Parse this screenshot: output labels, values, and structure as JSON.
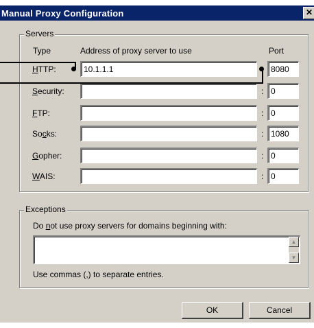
{
  "window": {
    "title": "Manual Proxy Configuration",
    "close_glyph": "✕"
  },
  "servers": {
    "group_label": "Servers",
    "col_type": "Type",
    "col_address": "Address of proxy server to use",
    "col_port": "Port",
    "rows": [
      {
        "label": "HTTP:",
        "address": "10.1.1.1",
        "port": "8080"
      },
      {
        "label": "Security:",
        "address": "",
        "port": "0"
      },
      {
        "label": "FTP:",
        "address": "",
        "port": "0"
      },
      {
        "label": "Socks:",
        "address": "",
        "port": "1080"
      },
      {
        "label": "Gopher:",
        "address": "",
        "port": "0"
      },
      {
        "label": "WAIS:",
        "address": "",
        "port": "0"
      }
    ],
    "colon": ":"
  },
  "exceptions": {
    "group_label": "Exceptions",
    "instruction": "Do not use proxy servers for domains beginning with:",
    "value": "",
    "hint": "Use commas (,) to separate entries."
  },
  "buttons": {
    "ok": "OK",
    "cancel": "Cancel"
  },
  "colors": {
    "titlebar": "#0a246a",
    "face": "#d4d0c8"
  }
}
